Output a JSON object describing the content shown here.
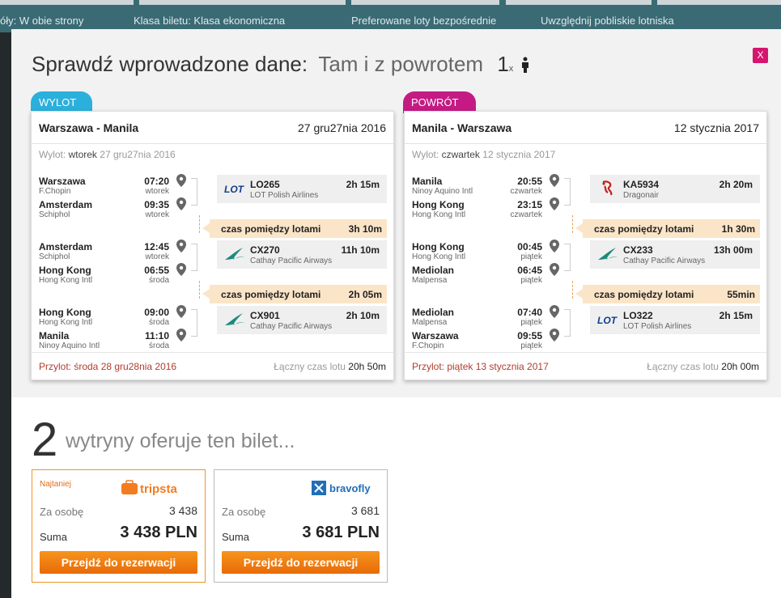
{
  "background": {
    "text1": "óły: W obie strony",
    "text2": "Klasa biletu: Klasa ekonomiczna",
    "text3": "Preferowane loty bezpośrednie",
    "text4": "Uwzględnij pobliskie lotniska"
  },
  "modal": {
    "close_label": "X",
    "title": "Sprawdź wprowadzone dane:",
    "trip_type": "Tam i z powrotem",
    "passengers": "1",
    "passengers_x": "x"
  },
  "outbound": {
    "tag": "WYLOT",
    "route": "Warszawa - Manila",
    "date": "27 gru27nia 2016",
    "dep_label": "Wylot:",
    "dep_day": "wtorek",
    "dep_date": "27 gru27nia 2016",
    "legs": [
      {
        "from_city": "Warszawa",
        "from_airport": "F.Chopin",
        "from_time": "07:20",
        "from_day": "wtorek",
        "to_city": "Amsterdam",
        "to_airport": "Schiphol",
        "to_time": "09:35",
        "to_day": "wtorek",
        "flight": "LO265",
        "airline": "LOT Polish Airlines",
        "duration": "2h 15m"
      },
      {
        "from_city": "Amsterdam",
        "from_airport": "Schiphol",
        "from_time": "12:45",
        "from_day": "wtorek",
        "to_city": "Hong Kong",
        "to_airport": "Hong Kong Intl",
        "to_time": "06:55",
        "to_day": "środa",
        "flight": "CX270",
        "airline": "Cathay Pacific Airways",
        "duration": "11h 10m"
      },
      {
        "from_city": "Hong Kong",
        "from_airport": "Hong Kong Intl",
        "from_time": "09:00",
        "from_day": "środa",
        "to_city": "Manila",
        "to_airport": "Ninoy Aquino Intl",
        "to_time": "11:10",
        "to_day": "środa",
        "flight": "CX901",
        "airline": "Cathay Pacific Airways",
        "duration": "2h 10m"
      }
    ],
    "connections": [
      {
        "label": "czas pomiędzy lotami",
        "duration": "3h 10m"
      },
      {
        "label": "czas pomiędzy lotami",
        "duration": "2h 05m"
      }
    ],
    "arrival": "Przylot: środa 28 gru28nia 2016",
    "total_label": "Łączny czas lotu",
    "total": "20h 50m"
  },
  "return": {
    "tag": "POWRÓT",
    "route": "Manila - Warszawa",
    "date": "12 stycznia 2017",
    "dep_label": "Wylot:",
    "dep_day": "czwartek",
    "dep_date": "12 stycznia 2017",
    "legs": [
      {
        "from_city": "Manila",
        "from_airport": "Ninoy Aquino Intl",
        "from_time": "20:55",
        "from_day": "czwartek",
        "to_city": "Hong Kong",
        "to_airport": "Hong Kong Intl",
        "to_time": "23:15",
        "to_day": "czwartek",
        "flight": "KA5934",
        "airline": "Dragonair",
        "duration": "2h 20m"
      },
      {
        "from_city": "Hong Kong",
        "from_airport": "Hong Kong Intl",
        "from_time": "00:45",
        "from_day": "piątek",
        "to_city": "Mediolan",
        "to_airport": "Malpensa",
        "to_time": "06:45",
        "to_day": "piątek",
        "flight": "CX233",
        "airline": "Cathay Pacific Airways",
        "duration": "13h 00m"
      },
      {
        "from_city": "Mediolan",
        "from_airport": "Malpensa",
        "from_time": "07:40",
        "from_day": "piątek",
        "to_city": "Warszawa",
        "to_airport": "F.Chopin",
        "to_time": "09:55",
        "to_day": "piątek",
        "flight": "LO322",
        "airline": "LOT Polish Airlines",
        "duration": "2h 15m"
      }
    ],
    "connections": [
      {
        "label": "czas pomiędzy lotami",
        "duration": "1h 30m"
      },
      {
        "label": "czas pomiędzy lotami",
        "duration": "55min"
      }
    ],
    "arrival": "Przylot: piątek 13 stycznia 2017",
    "total_label": "Łączny czas lotu",
    "total": "20h 00m"
  },
  "offers": {
    "count": "2",
    "count_text": "wytryny oferuje ten bilet...",
    "items": [
      {
        "badge": "Najtaniej",
        "vendor": "tripsta",
        "per_person_label": "Za osobę",
        "per_person": "3 438",
        "sum_label": "Suma",
        "sum": "3 438 PLN",
        "button": "Przejdź do rezerwacji"
      },
      {
        "vendor": "bravofly",
        "per_person_label": "Za osobę",
        "per_person": "3 681",
        "sum_label": "Suma",
        "sum": "3 681 PLN",
        "button": "Przejdź do rezerwacji"
      }
    ]
  },
  "colors": {
    "outbound_accent": "#2bb0dc",
    "return_accent": "#c51a84",
    "close_button": "#d6156f",
    "book_button": "#f7941d",
    "connection_bg": "#fbe5c8"
  }
}
